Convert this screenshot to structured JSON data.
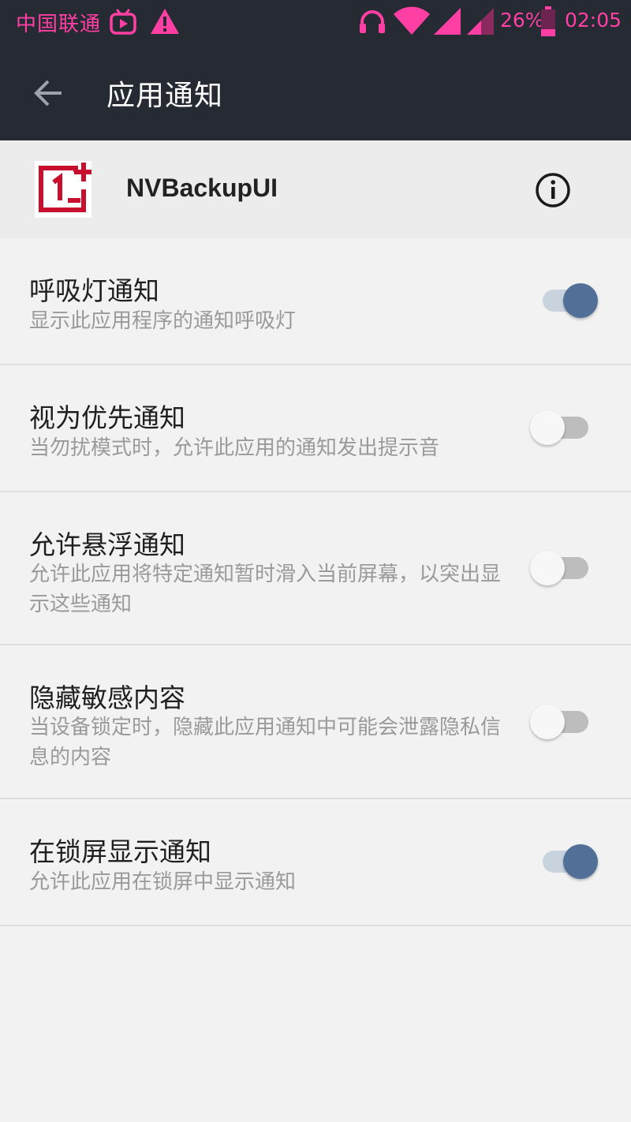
{
  "status_bar": {
    "carrier": "中国联通",
    "battery": "26%",
    "time": "02:05"
  },
  "toolbar": {
    "title": "应用通知"
  },
  "app": {
    "name": "NVBackupUI"
  },
  "settings": [
    {
      "title": "呼吸灯通知",
      "subtitle": "显示此应用程序的通知呼吸灯",
      "enabled": true
    },
    {
      "title": "视为优先通知",
      "subtitle": "当勿扰模式时，允许此应用的通知发出提示音",
      "enabled": false
    },
    {
      "title": "允许悬浮通知",
      "subtitle": "允许此应用将特定通知暂时滑入当前屏幕，以突出显示这些通知",
      "enabled": false
    },
    {
      "title": "隐藏敏感内容",
      "subtitle": "当设备锁定时，隐藏此应用通知中可能会泄露隐私信息的内容",
      "enabled": false
    },
    {
      "title": "在锁屏显示通知",
      "subtitle": "允许此应用在锁屏中显示通知",
      "enabled": true
    }
  ],
  "colors": {
    "status_accent": "#ff3fa4",
    "toolbar_bg": "#262a33",
    "switch_on": "#516f97",
    "logo_red": "#c8102e"
  },
  "icons": {
    "back": "arrow-left-icon",
    "info": "info-circle-icon",
    "status": [
      "tv-icon",
      "warning-icon",
      "headphones-icon",
      "wifi-icon",
      "signal-icon",
      "signal-icon",
      "battery-icon"
    ]
  }
}
